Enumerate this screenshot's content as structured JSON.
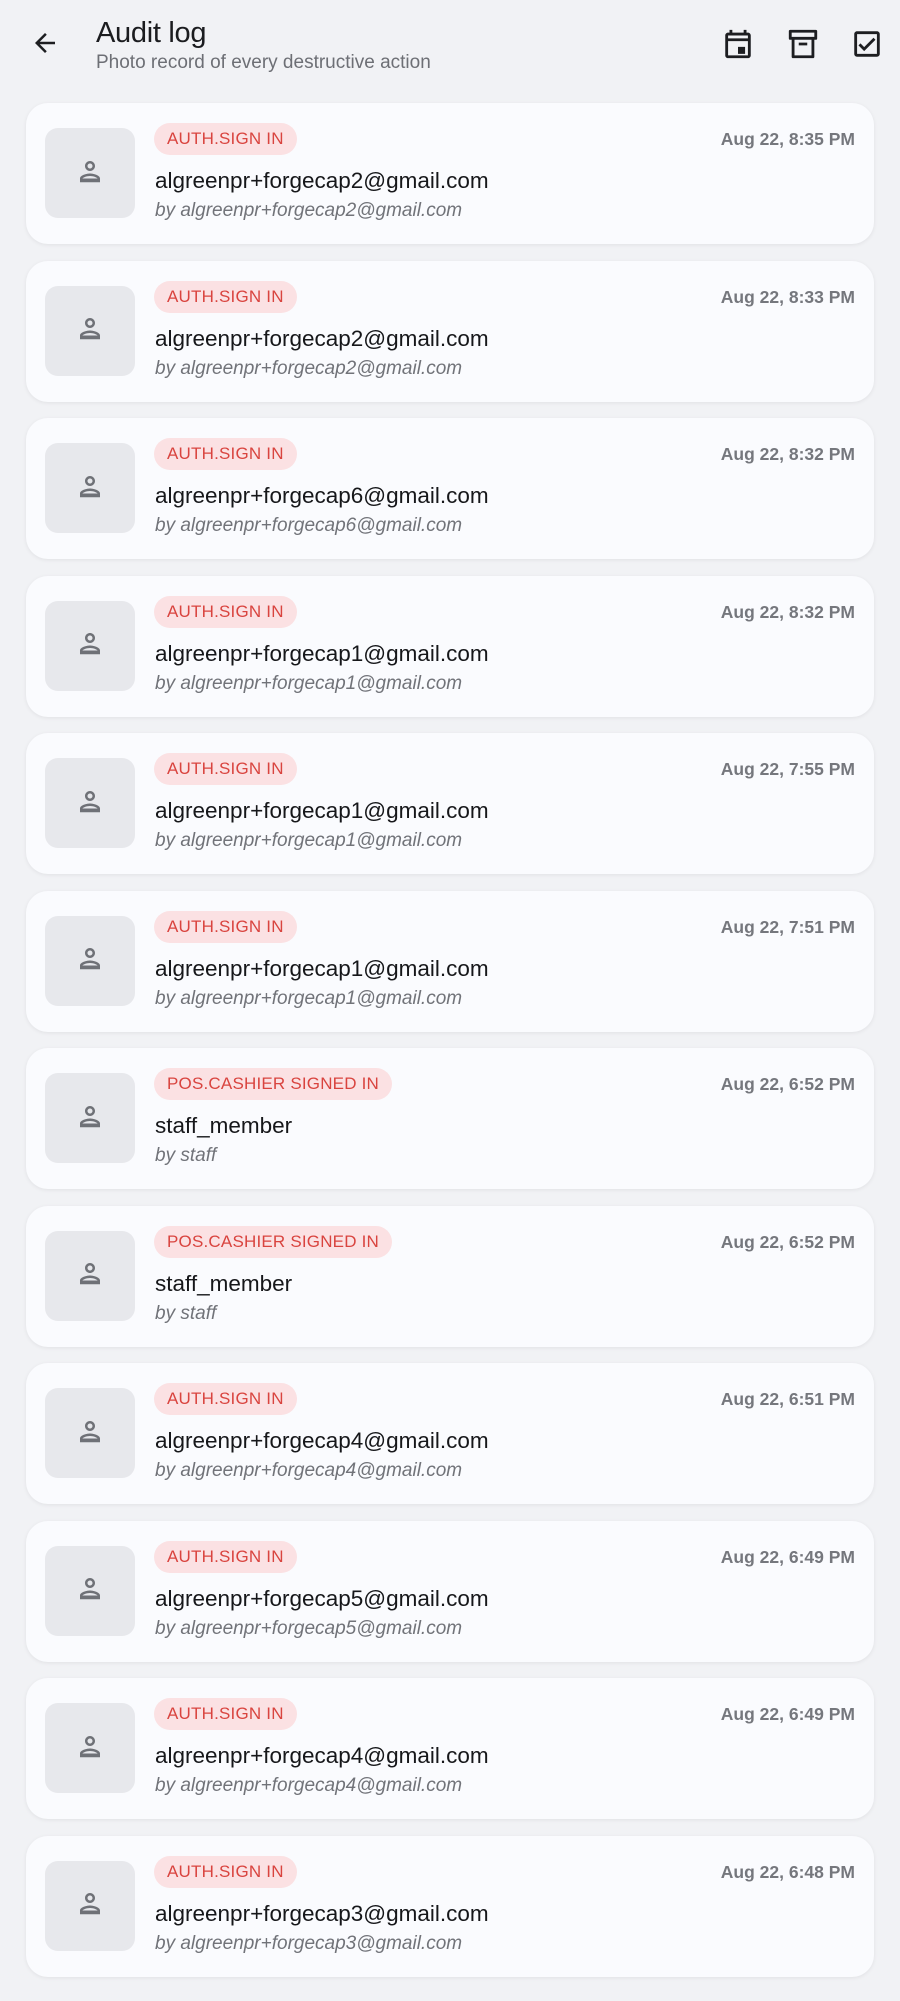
{
  "header": {
    "title": "Audit log",
    "subtitle": "Photo record of every destructive action",
    "back_icon": "arrow-back-icon",
    "actions": [
      "calendar-icon",
      "archive-icon",
      "checkbox-icon"
    ]
  },
  "colors": {
    "background": "#f1f2f5",
    "card": "#fafbfe",
    "badge_bg": "#fbe1e3",
    "badge_text": "#d9443f"
  },
  "entries": [
    {
      "badge": "AUTH.SIGN IN",
      "time": "Aug 22, 8:35 PM",
      "primary": "algreenpr+forgecap2@gmail.com",
      "actor": "by algreenpr+forgecap2@gmail.com"
    },
    {
      "badge": "AUTH.SIGN IN",
      "time": "Aug 22, 8:33 PM",
      "primary": "algreenpr+forgecap2@gmail.com",
      "actor": "by algreenpr+forgecap2@gmail.com"
    },
    {
      "badge": "AUTH.SIGN IN",
      "time": "Aug 22, 8:32 PM",
      "primary": "algreenpr+forgecap6@gmail.com",
      "actor": "by algreenpr+forgecap6@gmail.com"
    },
    {
      "badge": "AUTH.SIGN IN",
      "time": "Aug 22, 8:32 PM",
      "primary": "algreenpr+forgecap1@gmail.com",
      "actor": "by algreenpr+forgecap1@gmail.com"
    },
    {
      "badge": "AUTH.SIGN IN",
      "time": "Aug 22, 7:55 PM",
      "primary": "algreenpr+forgecap1@gmail.com",
      "actor": "by algreenpr+forgecap1@gmail.com"
    },
    {
      "badge": "AUTH.SIGN IN",
      "time": "Aug 22, 7:51 PM",
      "primary": "algreenpr+forgecap1@gmail.com",
      "actor": "by algreenpr+forgecap1@gmail.com"
    },
    {
      "badge": "POS.CASHIER SIGNED IN",
      "time": "Aug 22, 6:52 PM",
      "primary": "staff_member",
      "actor": "by staff"
    },
    {
      "badge": "POS.CASHIER SIGNED IN",
      "time": "Aug 22, 6:52 PM",
      "primary": "staff_member",
      "actor": "by staff"
    },
    {
      "badge": "AUTH.SIGN IN",
      "time": "Aug 22, 6:51 PM",
      "primary": "algreenpr+forgecap4@gmail.com",
      "actor": "by algreenpr+forgecap4@gmail.com"
    },
    {
      "badge": "AUTH.SIGN IN",
      "time": "Aug 22, 6:49 PM",
      "primary": "algreenpr+forgecap5@gmail.com",
      "actor": "by algreenpr+forgecap5@gmail.com"
    },
    {
      "badge": "AUTH.SIGN IN",
      "time": "Aug 22, 6:49 PM",
      "primary": "algreenpr+forgecap4@gmail.com",
      "actor": "by algreenpr+forgecap4@gmail.com"
    },
    {
      "badge": "AUTH.SIGN IN",
      "time": "Aug 22, 6:48 PM",
      "primary": "algreenpr+forgecap3@gmail.com",
      "actor": "by algreenpr+forgecap3@gmail.com"
    }
  ]
}
